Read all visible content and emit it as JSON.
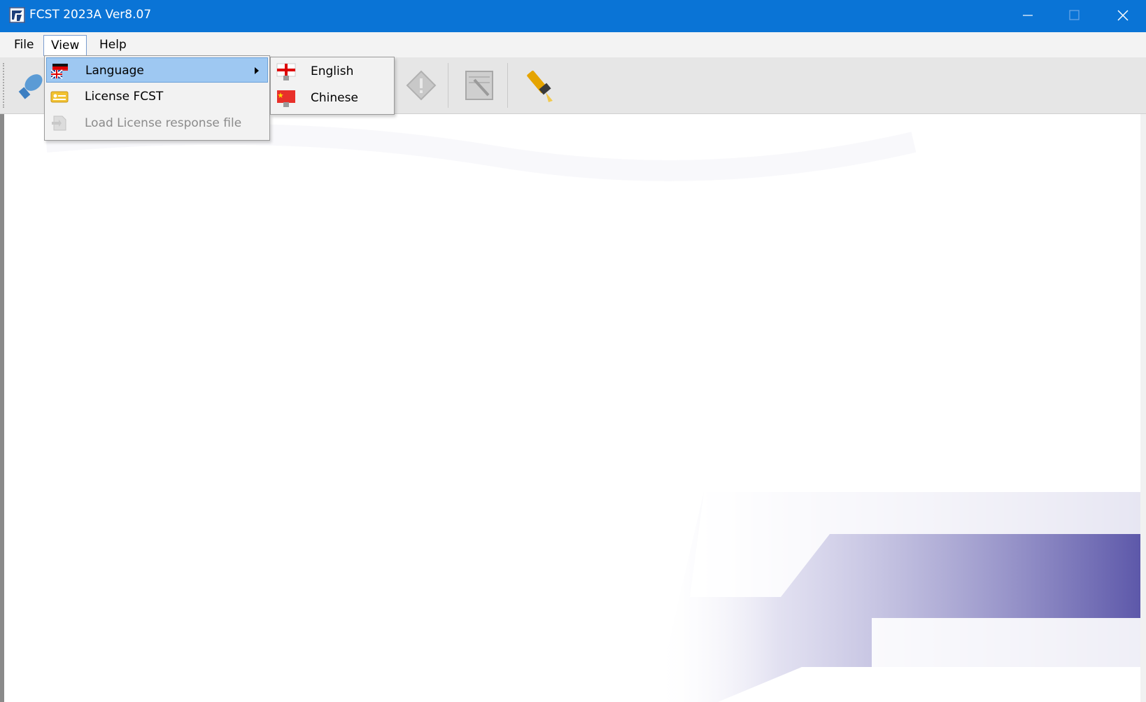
{
  "window": {
    "title": "FCST 2023A Ver8.07",
    "icon": "app-logo-icon",
    "titlebar_color": "#0a74d6",
    "controls": [
      "minimize-icon",
      "maximize-icon",
      "close-icon"
    ]
  },
  "menubar": {
    "items": [
      {
        "label": "File"
      },
      {
        "label": "View",
        "active": true
      },
      {
        "label": "Help"
      }
    ]
  },
  "toolbar": {
    "buttons": [
      {
        "icon": "connect-plug-icon"
      },
      {
        "icon": "warning-diamond-icon",
        "disabled": true
      },
      {
        "icon": "notepad-edit-icon",
        "disabled": true
      },
      {
        "icon": "flashlight-icon"
      }
    ]
  },
  "view_menu": {
    "items": [
      {
        "label": "Language",
        "icon": "language-flag-icon",
        "highlighted": true,
        "has_submenu": true
      },
      {
        "label": "License FCST",
        "icon": "license-card-icon"
      },
      {
        "label": "Load License response file",
        "icon": "load-file-icon",
        "disabled": true
      }
    ]
  },
  "language_submenu": {
    "items": [
      {
        "label": "English",
        "icon": "england-flag-icon"
      },
      {
        "label": "Chinese",
        "icon": "china-flag-icon"
      }
    ]
  },
  "colors": {
    "menu_highlight": "#9ec8f2",
    "watermark": "#5a55a8"
  }
}
